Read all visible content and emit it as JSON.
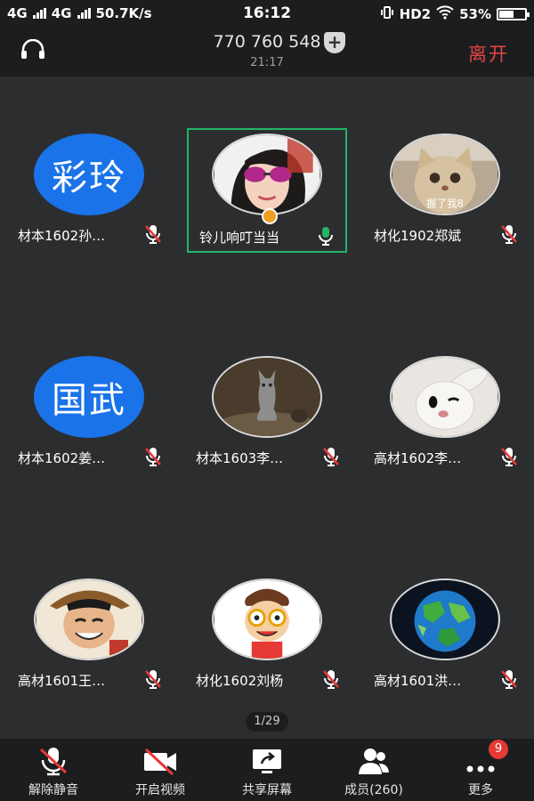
{
  "status_bar": {
    "network1": "4G",
    "network2": "4G",
    "speed": "50.7K/s",
    "time": "16:12",
    "hd": "HD2",
    "battery": "53%"
  },
  "header": {
    "meeting_id": "770 760 548",
    "duration": "21:17",
    "leave_label": "离开"
  },
  "participants": [
    {
      "name": "材本1602孙…",
      "avatar_text": "彩玲",
      "muted": true
    },
    {
      "name": "铃儿响叮当当",
      "avatar_icon": "woman-sunglasses-photo",
      "muted": false,
      "active": true
    },
    {
      "name": "材化1902郑斌",
      "avatar_icon": "cat-photo",
      "avatar_caption": "握了我8",
      "muted": true
    },
    {
      "name": "材本1602姜…",
      "avatar_text": "国武",
      "muted": true
    },
    {
      "name": "材本1603李…",
      "avatar_icon": "cat-statue-photo",
      "muted": true
    },
    {
      "name": "高材1602李…",
      "avatar_icon": "white-rabbit-photo",
      "muted": true
    },
    {
      "name": "高材1601王…",
      "avatar_icon": "anime-man-photo",
      "muted": true
    },
    {
      "name": "材化1602刘杨",
      "avatar_icon": "cartoon-boy-glasses",
      "muted": true
    },
    {
      "name": "高材1601洪…",
      "avatar_icon": "low-poly-earth",
      "muted": true
    }
  ],
  "pager": "1/29",
  "toolbar": {
    "unmute": "解除静音",
    "start_video": "开启视频",
    "share_screen": "共享屏幕",
    "members": "成员(260)",
    "more": "更多",
    "more_badge": "9"
  },
  "colors": {
    "accent_blue": "#1a73e8",
    "leave_red": "#e64545",
    "active_green": "#22b566",
    "mic_green": "#22b566"
  }
}
